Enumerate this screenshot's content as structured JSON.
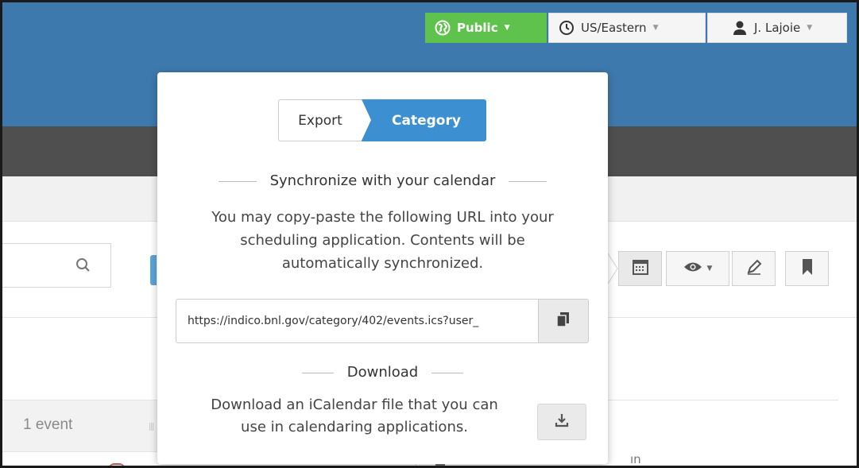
{
  "header": {
    "privacy_label": "Public",
    "timezone_label": "US/Eastern",
    "user_label": "J. Lajoie"
  },
  "popup": {
    "tabs": [
      "Export",
      "Category"
    ],
    "sync_title": "Synchronize with your calendar",
    "sync_desc_lines": [
      "You may copy-paste the following URL into your",
      "scheduling application. Contents will be",
      "automatically synchronized."
    ],
    "ics_url": "https://indico.bnl.gov/category/402/events.ics?user_",
    "download_title": "Download",
    "download_desc_lines": [
      "Download an iCalendar file that you can",
      "use in calendaring applications."
    ]
  },
  "background": {
    "event_count": "1 event",
    "partial_name": "ın"
  },
  "colors": {
    "header_blue": "#3e79ad",
    "public_green": "#5fc24c",
    "category_tab_blue": "#3c8fd1",
    "dark_band": "#4f4f4f"
  }
}
